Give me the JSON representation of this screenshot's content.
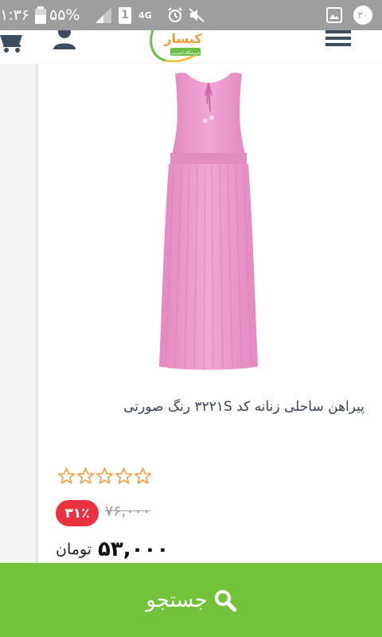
{
  "status_bar": {
    "time": "۱:۳۶",
    "battery": "۵۵%",
    "sim_slot": "1",
    "network": "4G",
    "notification_count": "۳۰"
  },
  "header": {
    "logo_text": "کیسار",
    "logo_tagline": "فروشگاه اینترنتی"
  },
  "product": {
    "title": "پیراهن ساحلی زنانه کد ۳۲۲۱S رنگ صورتی",
    "rating": 0,
    "rating_max": 5,
    "discount_badge": "۳۱٪",
    "old_price": "۷۶,۰۰۰",
    "new_price": "۵۳,۰۰۰",
    "currency": "تومان"
  },
  "bottom_bar": {
    "search_label": "جستجو"
  },
  "colors": {
    "status_bar": "#9e9e9e",
    "accent_green": "#72c33a",
    "discount_red": "#e8323f",
    "dress_pink": "#ec9ccc",
    "star_orange": "#f39a3a"
  }
}
